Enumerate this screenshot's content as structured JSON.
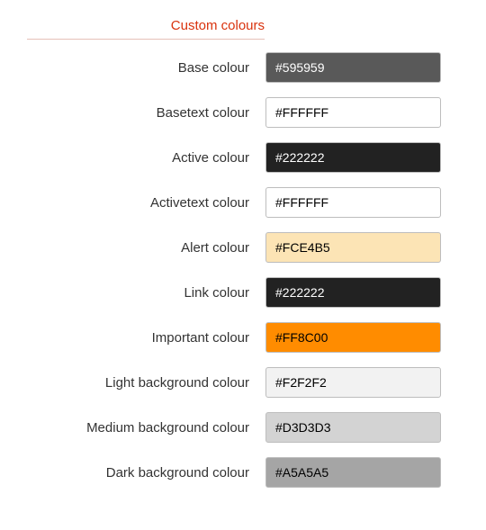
{
  "section_title": "Custom colours",
  "fields": [
    {
      "label": "Base colour",
      "value": "#595959",
      "bg": "#595959",
      "text": "#FFFFFF"
    },
    {
      "label": "Basetext colour",
      "value": "#FFFFFF",
      "bg": "#FFFFFF",
      "text": "#000000"
    },
    {
      "label": "Active colour",
      "value": "#222222",
      "bg": "#222222",
      "text": "#FFFFFF"
    },
    {
      "label": "Activetext colour",
      "value": "#FFFFFF",
      "bg": "#FFFFFF",
      "text": "#000000"
    },
    {
      "label": "Alert colour",
      "value": "#FCE4B5",
      "bg": "#FCE4B5",
      "text": "#000000"
    },
    {
      "label": "Link colour",
      "value": "#222222",
      "bg": "#222222",
      "text": "#FFFFFF"
    },
    {
      "label": "Important colour",
      "value": "#FF8C00",
      "bg": "#FF8C00",
      "text": "#000000"
    },
    {
      "label": "Light background colour",
      "value": "#F2F2F2",
      "bg": "#F2F2F2",
      "text": "#000000"
    },
    {
      "label": "Medium background colour",
      "value": "#D3D3D3",
      "bg": "#D3D3D3",
      "text": "#000000"
    },
    {
      "label": "Dark background colour",
      "value": "#A5A5A5",
      "bg": "#A5A5A5",
      "text": "#000000"
    }
  ]
}
